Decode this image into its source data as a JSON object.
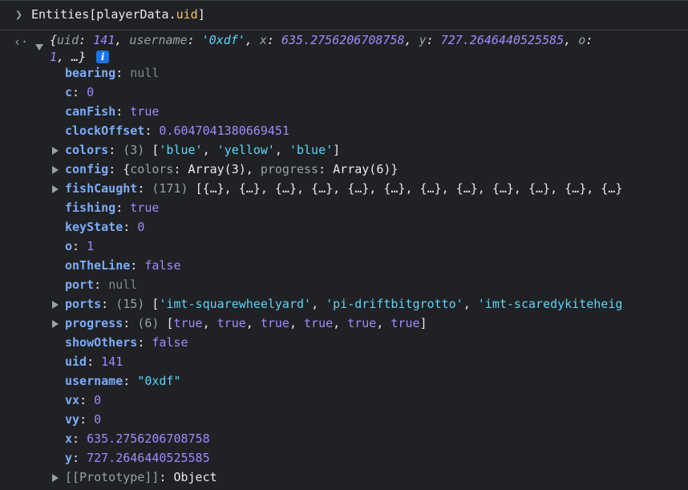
{
  "input": {
    "prompt_icon": "chevron-right-icon",
    "expression_prefix": "Entities[playerData.",
    "expression_prop": "uid",
    "expression_suffix": "]"
  },
  "result": {
    "back_icon": "return-arrow-icon",
    "preview_open": "{",
    "preview_uid_key": "uid",
    "preview_uid_val": "141",
    "preview_username_key": "username",
    "preview_username_val": "'0xdf'",
    "preview_x_key": "x",
    "preview_x_val": "635.2756206708758",
    "preview_y_key": "y",
    "preview_y_val": "727.2646440525585",
    "preview_o_key": "o",
    "preview_o_val": "1",
    "preview_tail": "…}",
    "info_badge": "i"
  },
  "rows": [
    {
      "key": "bearing",
      "value": "null",
      "type": "nul",
      "expandable": false
    },
    {
      "key": "c",
      "value": "0",
      "type": "num",
      "expandable": false
    },
    {
      "key": "canFish",
      "value": "true",
      "type": "bool",
      "expandable": false
    },
    {
      "key": "clockOffset",
      "value": "0.6047041380669451",
      "type": "num",
      "expandable": false
    },
    {
      "key": "colors",
      "value": "(3) ['blue', 'yellow', 'blue']",
      "type": "colors",
      "expandable": true
    },
    {
      "key": "config",
      "value": "{colors: Array(3), progress: Array(6)}",
      "type": "config",
      "expandable": true
    },
    {
      "key": "fishCaught",
      "value": "(171) [{…}, {…}, {…}, {…}, {…}, {…}, {…}, {…}, {…}, {…}, {…}, {…}",
      "type": "fish",
      "expandable": true
    },
    {
      "key": "fishing",
      "value": "true",
      "type": "bool",
      "expandable": false
    },
    {
      "key": "keyState",
      "value": "0",
      "type": "num",
      "expandable": false
    },
    {
      "key": "o",
      "value": "1",
      "type": "num",
      "expandable": false
    },
    {
      "key": "onTheLine",
      "value": "false",
      "type": "bool",
      "expandable": false
    },
    {
      "key": "port",
      "value": "null",
      "type": "nul",
      "expandable": false
    },
    {
      "key": "ports",
      "value": "(15) ['imt-squarewheelyard', 'pi-driftbitgrotto', 'imt-scaredykiteheig",
      "type": "ports",
      "expandable": true
    },
    {
      "key": "progress",
      "value": "(6) [true, true, true, true, true, true]",
      "type": "progress",
      "expandable": true
    },
    {
      "key": "showOthers",
      "value": "false",
      "type": "bool",
      "expandable": false
    },
    {
      "key": "uid",
      "value": "141",
      "type": "num",
      "expandable": false
    },
    {
      "key": "username",
      "value": "\"0xdf\"",
      "type": "str",
      "expandable": false
    },
    {
      "key": "vx",
      "value": "0",
      "type": "num",
      "expandable": false
    },
    {
      "key": "vy",
      "value": "0",
      "type": "num",
      "expandable": false
    },
    {
      "key": "x",
      "value": "635.2756206708758",
      "type": "num",
      "expandable": false
    },
    {
      "key": "y",
      "value": "727.2646440525585",
      "type": "num",
      "expandable": false
    },
    {
      "key": "[[Prototype]]",
      "value": "Object",
      "type": "proto",
      "expandable": true
    }
  ],
  "colors": {
    "background": "#202124",
    "key": "#7cacf8",
    "number": "#9d8cff",
    "string": "#5cd5f7",
    "null": "#80868b"
  }
}
